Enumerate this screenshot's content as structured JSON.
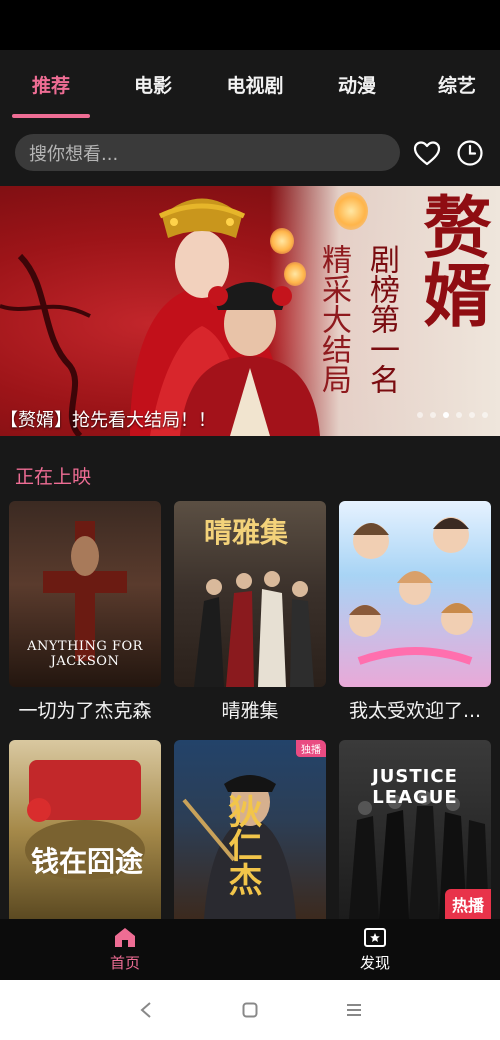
{
  "tabs": [
    {
      "label": "推荐",
      "active": true
    },
    {
      "label": "电影",
      "active": false
    },
    {
      "label": "电视剧",
      "active": false
    },
    {
      "label": "动漫",
      "active": false
    },
    {
      "label": "综艺",
      "active": false
    }
  ],
  "search": {
    "placeholder": "搜你想看..."
  },
  "icons": {
    "favorite": "heart-icon",
    "history": "clock-icon"
  },
  "banner": {
    "title": "赘婿",
    "subtitle_1": "剧榜第一名",
    "subtitle_2": "精采大结局",
    "caption": "【赘婿】抢先看大结局！！",
    "slide_count": 6,
    "active_slide": 3
  },
  "section": {
    "title": "正在上映"
  },
  "movies": [
    {
      "title": "一切为了杰克森",
      "poster_text": "ANYTHING FOR JACKSON",
      "badge": ""
    },
    {
      "title": "晴雅集",
      "poster_text": "晴雅集",
      "badge": ""
    },
    {
      "title": "我太受欢迎了...",
      "poster_text": "",
      "badge": ""
    },
    {
      "title": "",
      "poster_text": "钱在囧途",
      "badge": ""
    },
    {
      "title": "",
      "poster_text": "狄仁杰",
      "badge": "独播"
    },
    {
      "title": "",
      "poster_text": "JUSTICE LEAGUE",
      "badge": "热播"
    }
  ],
  "bottom_nav": [
    {
      "label": "首页",
      "icon": "home-icon",
      "active": true
    },
    {
      "label": "发现",
      "icon": "discover-icon",
      "active": false
    }
  ],
  "colors": {
    "accent": "#ee6d94",
    "background": "#181818",
    "nav": "#0c0c0c"
  }
}
